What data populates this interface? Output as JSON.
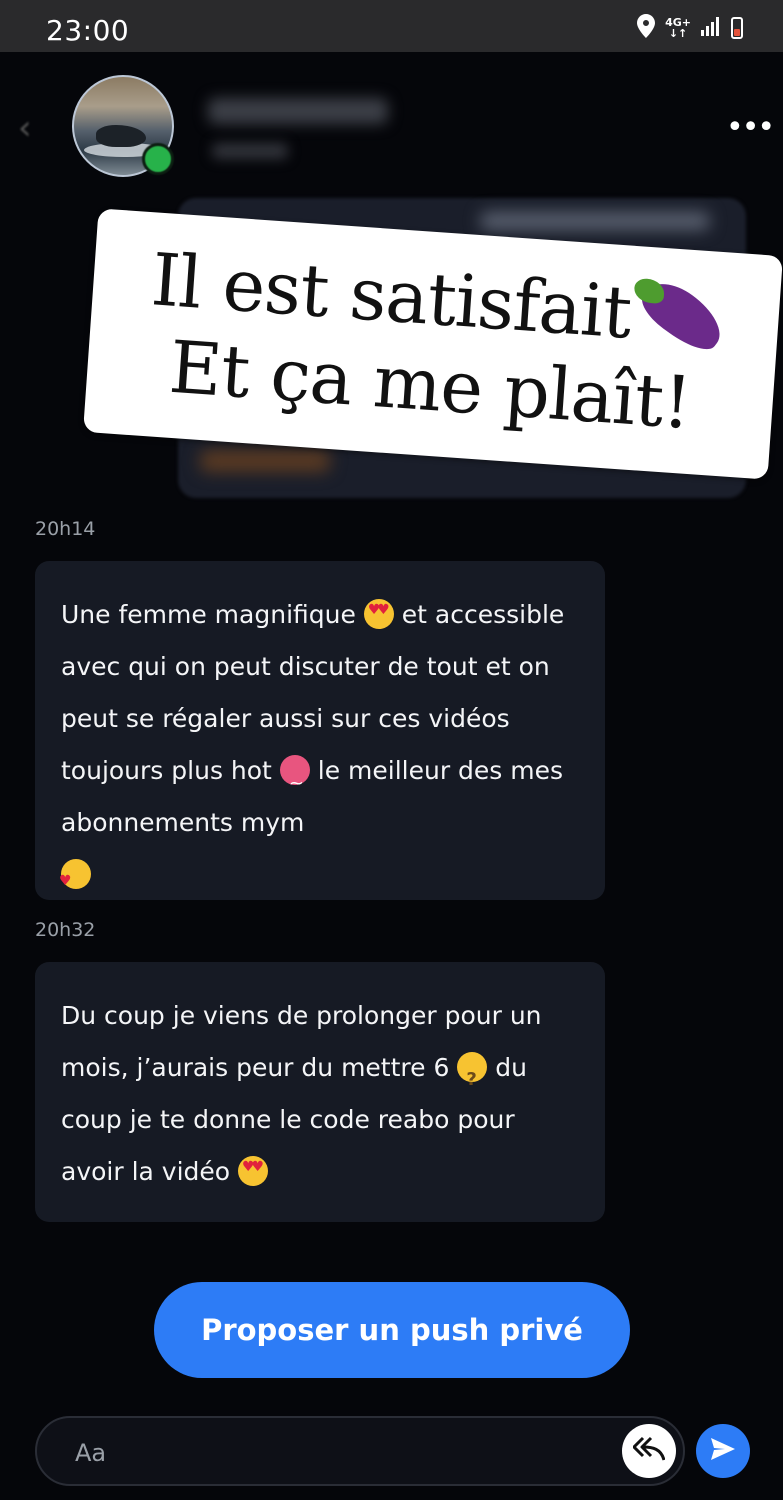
{
  "status_bar": {
    "time": "23:00",
    "network": "4G+",
    "battery_level": 0.4,
    "icons": [
      "location-icon",
      "signal-icon",
      "battery-icon"
    ]
  },
  "header": {
    "back_icon": "chevron-left-icon",
    "more_icon": "more-dots-icon",
    "online": true
  },
  "overlay": {
    "line1": "Il est satisfait",
    "line2": "Et ça me plaît!",
    "emoji": "eggplant"
  },
  "messages": [
    {
      "timestamp": "20h14",
      "parts": [
        {
          "t": "Une femme magnifique "
        },
        {
          "emoji": "heart-eyes"
        },
        {
          "t": " et accessible avec qui on peut discuter de tout et on peut se régaler aussi sur ces vidéos toujours plus hot "
        },
        {
          "emoji": "hot"
        },
        {
          "t": " le meilleur des mes abonnements mym\n"
        },
        {
          "emoji": "smiling-hearts"
        }
      ]
    },
    {
      "timestamp": "20h32",
      "parts": [
        {
          "t": "Du coup je viens de prolonger pour un mois, j’aurais peur du mettre 6 "
        },
        {
          "emoji": "thinking"
        },
        {
          "t": " du coup je te donne le code reabo pour avoir la vidéo "
        },
        {
          "emoji": "heart-eyes"
        }
      ]
    }
  ],
  "push_button": {
    "label": "Proposer un push privé"
  },
  "composer": {
    "placeholder": "Aa",
    "reply_icon": "reply-all-icon",
    "send_icon": "send-icon"
  },
  "colors": {
    "accent": "#2d7cf6",
    "bubble": "#161a24",
    "background": "#05060a"
  }
}
